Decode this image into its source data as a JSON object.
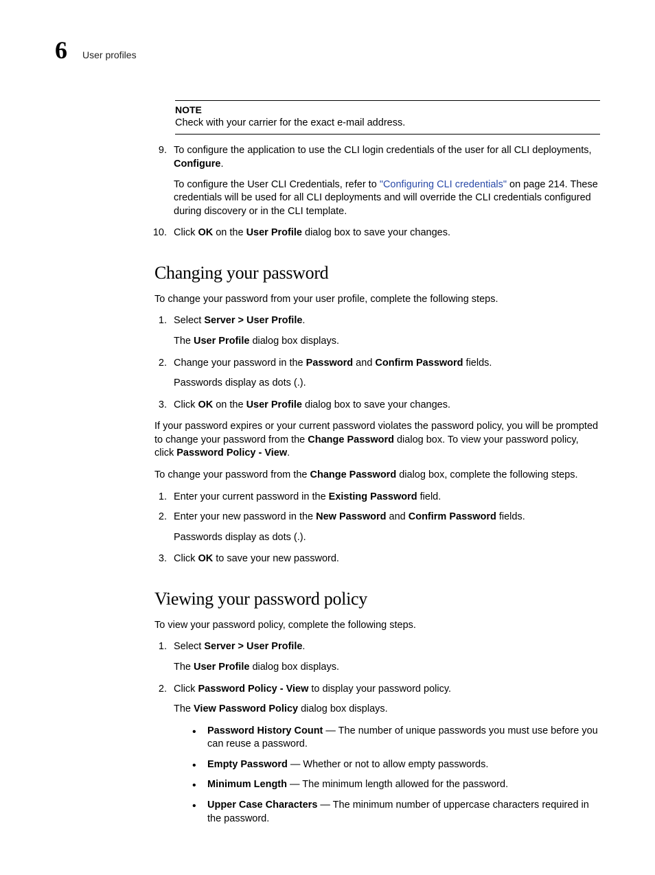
{
  "header": {
    "chapter_number": "6",
    "section": "User profiles"
  },
  "note": {
    "label": "NOTE",
    "text": "Check with your carrier for the exact e-mail address."
  },
  "top_steps": {
    "start": 9,
    "items": [
      {
        "pre": "To configure the application to use the CLI login credentials of the user for all CLI deployments, ",
        "bold_end": "Configure",
        "punct": ".",
        "sub_pre": "To configure the User CLI Credentials, refer to ",
        "sub_link": "\"Configuring CLI credentials\"",
        "sub_post": " on page 214. These credentials will be used for all CLI deployments and will override the CLI credentials configured during discovery or in the CLI template."
      },
      {
        "pre": "Click ",
        "b1": "OK",
        "mid": " on the ",
        "b2": "User Profile",
        "post": " dialog box to save your changes."
      }
    ]
  },
  "section1": {
    "heading": "Changing your password",
    "intro": "To change your password from your user profile, complete the following steps.",
    "list1": [
      {
        "pre": "Select ",
        "b1": "Server > User Profile",
        "post": ".",
        "sub_pre": "The ",
        "sub_b": "User Profile",
        "sub_post": " dialog box displays."
      },
      {
        "pre": "Change your password in the ",
        "b1": "Password",
        "mid": " and ",
        "b2": "Confirm Password",
        "post": " fields.",
        "sub_plain": "Passwords display as dots (.)."
      },
      {
        "pre": "Click ",
        "b1": "OK",
        "mid": " on the ",
        "b2": "User Profile",
        "post": " dialog box to save your changes."
      }
    ],
    "para1_pre": "If your password expires or your current password violates the password policy, you will be prompted to change your password from the ",
    "para1_b1": "Change Password",
    "para1_mid": " dialog box. To view your password policy, click ",
    "para1_b2": "Password Policy - View",
    "para1_post": ".",
    "para2_pre": "To change your password from the ",
    "para2_b": "Change Password",
    "para2_post": " dialog box, complete the following steps.",
    "list2": [
      {
        "pre": "Enter your current password in the ",
        "b1": "Existing Password",
        "post": " field."
      },
      {
        "pre": "Enter your new password in the ",
        "b1": "New Password",
        "mid": " and ",
        "b2": "Confirm Password",
        "post": " fields.",
        "sub_plain": "Passwords display as dots (.)."
      },
      {
        "pre": "Click ",
        "b1": "OK",
        "post": " to save your new password."
      }
    ]
  },
  "section2": {
    "heading": "Viewing your password policy",
    "intro": "To view your password policy, complete the following steps.",
    "list": [
      {
        "pre": "Select ",
        "b1": "Server > User Profile",
        "post": ".",
        "sub_pre": "The ",
        "sub_b": "User Profile",
        "sub_post": " dialog box displays."
      },
      {
        "pre": "Click ",
        "b1": "Password Policy - View",
        "post": " to display your password policy.",
        "sub_pre": "The ",
        "sub_b": "View Password Policy",
        "sub_post": " dialog box displays."
      }
    ],
    "bullets": [
      {
        "b": "Password History Count",
        "t": " — The number of unique passwords you must use before you can reuse a password."
      },
      {
        "b": "Empty Password",
        "t": " — Whether or not to allow empty passwords."
      },
      {
        "b": "Minimum Length",
        "t": " — The minimum length allowed for the password."
      },
      {
        "b": "Upper Case Characters",
        "t": " — The minimum number of uppercase characters required in the password."
      }
    ]
  }
}
